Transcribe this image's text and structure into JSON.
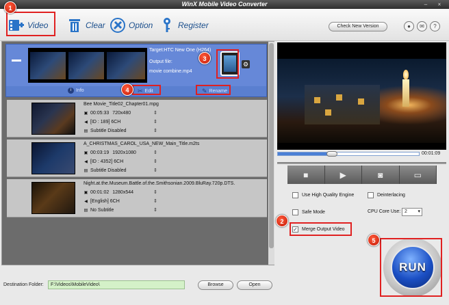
{
  "window": {
    "title": "WinX Mobile Video Converter",
    "minimize": "–",
    "close": "×"
  },
  "toolbar": {
    "video": "Video",
    "clear": "Clear",
    "option": "Option",
    "register": "Register",
    "check_version": "Check New Version"
  },
  "selected_item": {
    "target": "Target:HTC New One (H264)",
    "output_label": "Output file:",
    "output_file": "movie combine.mp4",
    "info": "Info",
    "edit": "Edit",
    "rename": "Rename"
  },
  "items": [
    {
      "name": "Bee Movie_Title02_Chapter01.mpg",
      "duration": "00:05:33",
      "resolution": "720x480",
      "audio": "[ID : 189] 6CH",
      "subtitle": "Subtitle Disabled"
    },
    {
      "name": "A_CHRISTMAS_CAROL_USA_NEW_Main_Title.m2ts",
      "duration": "00:03:19",
      "resolution": "1920x1080",
      "audio": "[ID : 4352] 6CH",
      "subtitle": "Subtitle Disabled"
    },
    {
      "name": "Night.at.the.Museum.Battle.of.the.Smithsonian.2009.BluRay.720p.DTS.",
      "duration": "00:01:02",
      "resolution": "1280x544",
      "audio": "[English] 6CH",
      "subtitle": "No Subtitle"
    }
  ],
  "preview": {
    "time": "00:01:09",
    "progress": 0.35
  },
  "options": {
    "high_quality": "Use High Quality Engine",
    "deinterlacing": "Deinterlacing",
    "safe_mode": "Safe Mode",
    "cpu_core_label": "CPU Core Use:",
    "cpu_core_value": "2",
    "merge_output": "Merge Output Video",
    "merge_checked": "✓"
  },
  "run": "RUN",
  "bottom": {
    "dest_label": "Destination Folder:",
    "dest_value": "F:\\Videos\\MobileVideo\\",
    "browse": "Browse",
    "open": "Open"
  },
  "badges": [
    "1",
    "2",
    "3",
    "4",
    "5"
  ]
}
